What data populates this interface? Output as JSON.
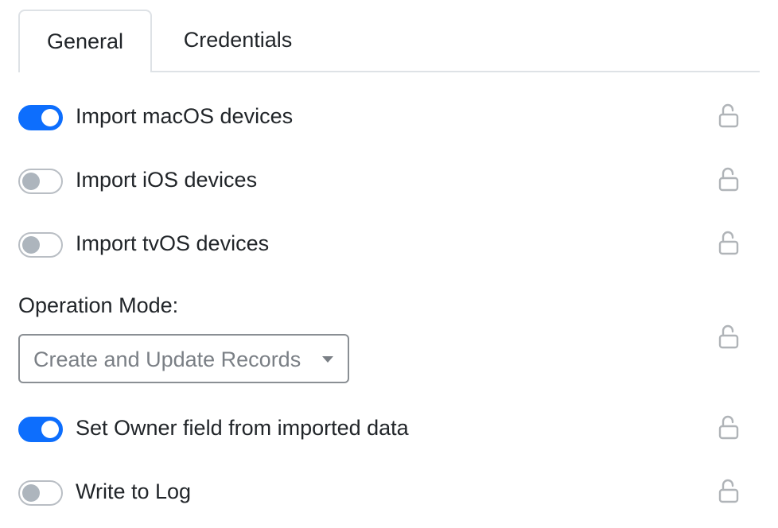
{
  "tabs": [
    {
      "label": "General",
      "active": true
    },
    {
      "label": "Credentials",
      "active": false
    }
  ],
  "toggles": [
    {
      "label": "Import macOS devices",
      "on": true,
      "locked": false
    },
    {
      "label": "Import iOS devices",
      "on": false,
      "locked": false
    },
    {
      "label": "Import tvOS devices",
      "on": false,
      "locked": false
    },
    {
      "label": "Set Owner field from imported data",
      "on": true,
      "locked": false
    },
    {
      "label": "Write to Log",
      "on": false,
      "locked": false
    }
  ],
  "operation_mode": {
    "label": "Operation Mode:",
    "selected": "Create and Update Records",
    "locked": false
  },
  "colors": {
    "accent": "#0d6efd",
    "toggle_off_knob": "#adb5bd",
    "lock_icon": "#b0b4b8"
  },
  "icons": {
    "lock": "unlocked-padlock-icon",
    "caret": "caret-down-icon"
  }
}
